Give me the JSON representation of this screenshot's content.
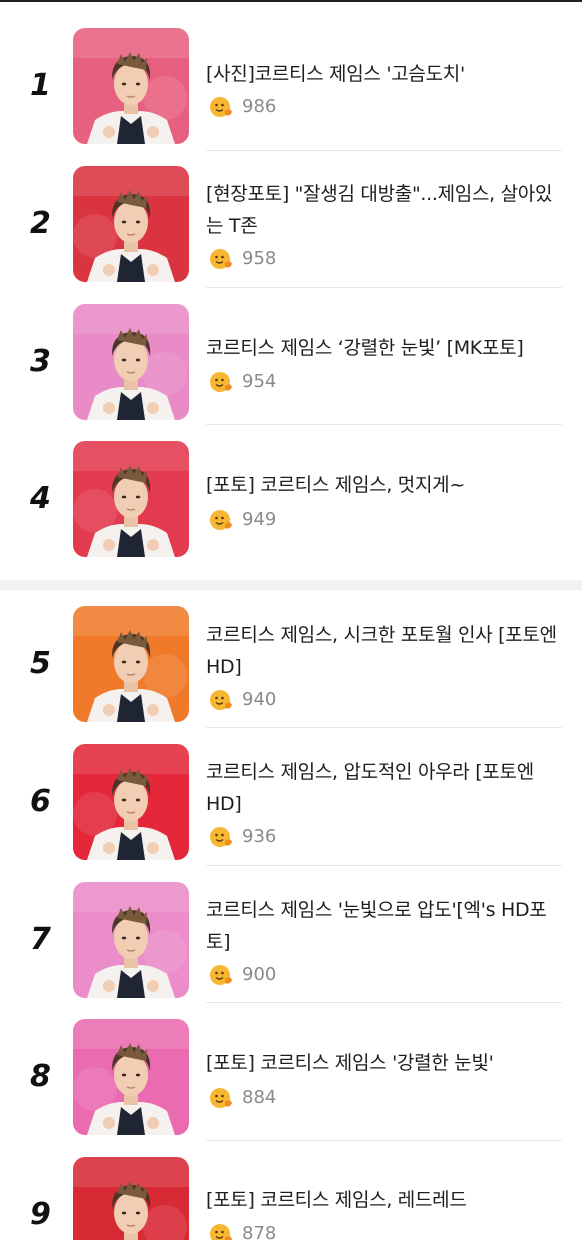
{
  "items": [
    {
      "rank": "1",
      "title": "[사진]코르티스 제임스 '고슴도치'",
      "count": "986",
      "photo": "photo-1",
      "bg": "#e8607f"
    },
    {
      "rank": "2",
      "title": "[현장포토] \"잘생김 대방출\"...제임스, 살아있는 T존",
      "count": "958",
      "photo": "photo-2",
      "bg": "#d93440"
    },
    {
      "rank": "3",
      "title": "코르티스 제임스 ‘강렬한 눈빛’ [MK포토]",
      "count": "954",
      "photo": "photo-3",
      "bg": "#e98bc6"
    },
    {
      "rank": "4",
      "title": "[포토] 코르티스 제임스, 멋지게~",
      "count": "949",
      "photo": "photo-4",
      "bg": "#e23a4e"
    },
    {
      "rank": "5",
      "title": "코르티스 제임스, 시크한 포토월 인사 [포토엔HD]",
      "count": "940",
      "photo": "photo-5",
      "bg": "#f07a2a"
    },
    {
      "rank": "6",
      "title": "코르티스 제임스, 압도적인 아우라 [포토엔HD]",
      "count": "936",
      "photo": "photo-6",
      "bg": "#e4283a"
    },
    {
      "rank": "7",
      "title": "코르티스 제임스 '눈빛으로 압도'[엑's HD포토]",
      "count": "900",
      "photo": "photo-7",
      "bg": "#ea8dc8"
    },
    {
      "rank": "8",
      "title": "[포토] 코르티스 제임스 '강렬한 눈빛'",
      "count": "884",
      "photo": "photo-8",
      "bg": "#ea6bb0"
    },
    {
      "rank": "9",
      "title": "[포토] 코르티스 제임스, 레드레드",
      "count": "878",
      "photo": "photo-9",
      "bg": "#d82a35"
    }
  ],
  "reaction_icon": "smile-emoji-icon",
  "colors": {
    "count_text": "#8a8a8a",
    "divider": "#e8e8e8",
    "section_gap": "#f2f2f4"
  }
}
